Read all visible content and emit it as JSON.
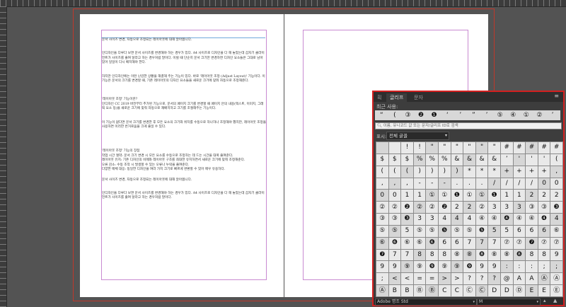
{
  "document": {
    "paragraphs": [
      "문서 사이즈 변경, 자동으로 조정되는 레이아웃에 대해 알아봅니다.",
      "인디자인을 다루다 보면 문서 사이즈를 변경해야 하는 경우가 있다. A4 사이즈로 디자인을 다 해 놓았는데 갑자기 클라이언트가 사이즈를 줄여 달라고 하는 경우처럼 말이다. 이럴 때 단순히 문서 크기만 변경하면 디자인 요소들은 그대로 남아 있어 일일이 다시 배치해야 한다.",
      "하지만 인디자인에는 이런 난감한 상황을 해결해 주는 기능이 있다. 바로 '레이아웃 조정 (Adjust Layout)' 기능이다. 이 기능은 문서의 크기를 변경할 때, 기존 레이아웃의 디자인 요소들을 새로운 크기에 맞춰 자동으로 조정해준다.",
      "'레이아웃 조정' 기능이란?",
      "인디자인 CC 2019 버전부터 추가된 기능으로, 문서의 페이지 크기를 변경할 때 페이지 안의 내용(텍스트, 이미지, 그래픽 요소 등)을 새로운 크기에 맞춰 자동으로 재배치하고 크기를 조절해주는 기능이다.",
      "이 기능이 없다면 문서 크기를 변경한 후 모든 요소의 크기와 위치를 수동으로 하나하나 조정해야 했지만, 레이아웃 조정을 사용하면 이러한 번거로움을 크게 줄일 수 있다.",
      "'레이아웃 조정' 기능의 장점",
      "작업 시간 절약: 문서 크기 변경 시 모든 요소를 수동으로 조정하는 데 드는 시간을 대폭 줄여준다.",
      "레이아웃 유지: 기존 디자인의 비례와 레이아웃 구조를 최대한 유지하면서 새로운 크기에 맞춰 조정해준다.",
      "오류 감소: 수동 조작 시 발생할 수 있는 오류나 누락을 줄여준다.",
      "다양한 매체 대응: 동일한 디자인을 여러 가지 크기로 빠르게 변환할 수 있어 매우 유용하다.",
      "문서 사이즈 변경, 자동으로 조정되는 레이아웃에 대해 알아봅니다.",
      "인디자인을 다루다 보면 문서 사이즈를 변경해야 하는 경우가 있다. A4 사이즈로 디자인을 다 해 놓았는데 갑자기 클라이언트가 사이즈를 줄여 달라고 하는 경우처럼 말이다."
    ]
  },
  "glyphs_panel": {
    "tabs": [
      "획",
      "글리프",
      "문자"
    ],
    "active_tab": "글리프",
    "recent_label": "최근 사용:",
    "recent": [
      "“",
      "(",
      "③",
      "❷",
      "❶",
      "‘",
      "’",
      "”",
      "’",
      "⑤",
      "④",
      "①",
      "②",
      "’"
    ],
    "search_placeholder": "이름, 유니코드 값 또는 문자/글리프 ID로 검색",
    "show_label": "표시:",
    "show_value": "전체 글꼴",
    "font_name": "Adobe 명조 Std",
    "font_style": "M",
    "glyph_rows": [
      [
        " ",
        " ",
        "!",
        "!",
        "\"",
        "\"",
        "\"",
        "\"",
        "\"",
        "\"",
        "#",
        "#",
        "#",
        "#",
        "#"
      ],
      [
        "$",
        "$",
        "$",
        "%",
        "%",
        "%",
        "&",
        "&",
        "&",
        "&",
        "’",
        "'",
        "'",
        "'",
        "("
      ],
      [
        "(",
        "(",
        "(",
        ")",
        ")",
        ")",
        ")",
        "*",
        "*",
        "*",
        "+",
        "+",
        "+",
        "+",
        ","
      ],
      [
        ",",
        ",",
        ",",
        "-",
        "-",
        "-",
        ".",
        ".",
        ".",
        "/",
        "/",
        "/",
        "/",
        "0",
        "0"
      ],
      [
        "0",
        "0",
        "1",
        "1",
        "①",
        "①",
        "❶",
        "①",
        "①",
        "❶",
        "1",
        "1",
        "2",
        "2",
        "2"
      ],
      [
        "②",
        "②",
        "❷",
        "②",
        "②",
        "❷",
        "2",
        "2",
        "②",
        "3",
        "3",
        "3",
        "③",
        "③",
        "❸"
      ],
      [
        "③",
        "③",
        "❸",
        "3",
        "3",
        "4",
        "4",
        "4",
        "④",
        "④",
        "❹",
        "④",
        "④",
        "❹",
        "4"
      ],
      [
        "⑤",
        "⑤",
        "5",
        "⑤",
        "⑤",
        "❺",
        "⑤",
        "⑤",
        "❺",
        "5",
        "5",
        "6",
        "6",
        "6",
        "⑥"
      ],
      [
        "⑥",
        "❻",
        "⑥",
        "⑥",
        "❻",
        "6",
        "6",
        "7",
        "7",
        "7",
        "⑦",
        "⑦",
        "❼",
        "⑦",
        "⑦"
      ],
      [
        "❼",
        "7",
        "7",
        "8",
        "8",
        "8",
        "⑧",
        "⑧",
        "❽",
        "⑧",
        "⑧",
        "❽",
        "8",
        "8",
        "9"
      ],
      [
        "9",
        "9",
        "⑨",
        "⑨",
        "❾",
        "⑨",
        "⑨",
        "❾",
        "9",
        "9",
        ":",
        ":",
        ":",
        ";",
        ";"
      ],
      [
        ";",
        "<",
        "<",
        "=",
        "=",
        ">",
        ">",
        "?",
        "?",
        "?",
        "@",
        "A",
        "A",
        "Ⓐ",
        "Ⓐ"
      ],
      [
        "Ⓐ",
        "B",
        "B",
        "Ⓑ",
        "Ⓑ",
        "C",
        "C",
        "Ⓒ",
        "Ⓒ",
        "D",
        "D",
        "Ⓓ",
        "E",
        "E",
        "Ⓔ"
      ]
    ]
  }
}
